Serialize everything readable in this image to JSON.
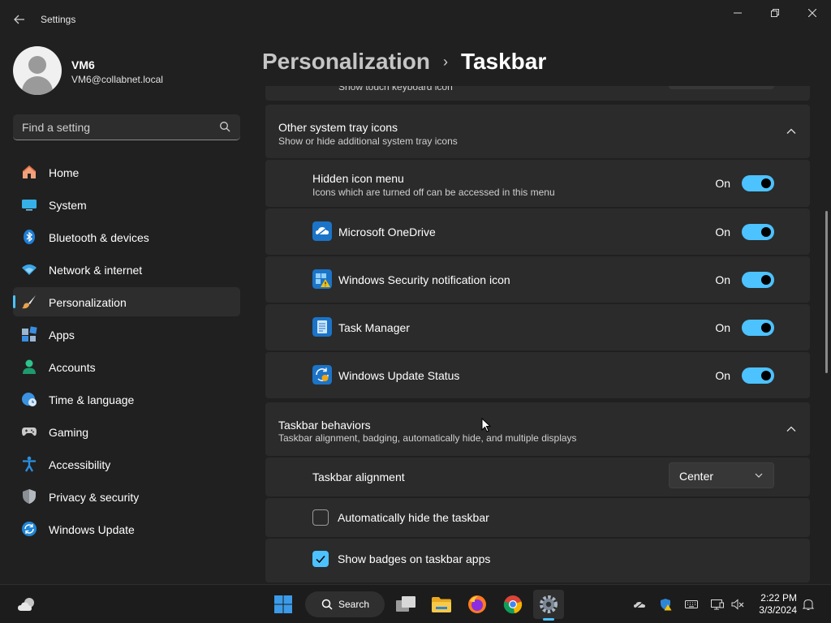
{
  "window": {
    "title": "Settings",
    "back_icon": "arrow-left-icon",
    "controls": [
      "minimize-icon",
      "maximize-icon",
      "close-icon"
    ]
  },
  "profile": {
    "name": "VM6",
    "email": "VM6@collabnet.local"
  },
  "search": {
    "placeholder": "Find a setting",
    "value": ""
  },
  "sidebar": {
    "items": [
      {
        "label": "Home",
        "icon": "home-icon"
      },
      {
        "label": "System",
        "icon": "monitor-icon"
      },
      {
        "label": "Bluetooth & devices",
        "icon": "bluetooth-icon"
      },
      {
        "label": "Network & internet",
        "icon": "wifi-icon"
      },
      {
        "label": "Personalization",
        "icon": "paintbrush-icon",
        "active": true
      },
      {
        "label": "Apps",
        "icon": "apps-icon"
      },
      {
        "label": "Accounts",
        "icon": "person-icon"
      },
      {
        "label": "Time & language",
        "icon": "globe-clock-icon"
      },
      {
        "label": "Gaming",
        "icon": "gamepad-icon"
      },
      {
        "label": "Accessibility",
        "icon": "accessibility-icon"
      },
      {
        "label": "Privacy & security",
        "icon": "shield-icon"
      },
      {
        "label": "Windows Update",
        "icon": "sync-icon"
      }
    ]
  },
  "header": {
    "parent": "Personalization",
    "separator": "›",
    "current": "Taskbar"
  },
  "partial_row": {
    "label": "Show touch keyboard icon"
  },
  "tray_section": {
    "title": "Other system tray icons",
    "subtitle": "Show or hide additional system tray icons",
    "rows": [
      {
        "title": "Hidden icon menu",
        "subtitle": "Icons which are turned off can be accessed in this menu",
        "state": "On",
        "enabled": true
      },
      {
        "title": "Microsoft OneDrive",
        "icon": "onedrive-icon",
        "state": "On",
        "enabled": true
      },
      {
        "title": "Windows Security notification icon",
        "icon": "windows-security-icon",
        "state": "On",
        "enabled": true
      },
      {
        "title": "Task Manager",
        "icon": "task-manager-icon",
        "state": "On",
        "enabled": true
      },
      {
        "title": "Windows Update Status",
        "icon": "windows-update-icon",
        "state": "On",
        "enabled": true
      }
    ]
  },
  "behaviors_section": {
    "title": "Taskbar behaviors",
    "subtitle": "Taskbar alignment, badging, automatically hide, and multiple displays",
    "alignment_label": "Taskbar alignment",
    "alignment_value": "Center",
    "auto_hide_label": "Automatically hide the taskbar",
    "auto_hide_checked": false,
    "badges_label": "Show badges on taskbar apps",
    "badges_checked": true
  },
  "taskbar": {
    "search_label": "Search",
    "apps": [
      "weather-icon",
      "windows-start-icon",
      "task-view-icon",
      "file-explorer-icon",
      "firefox-icon",
      "chrome-icon",
      "settings-gear-icon"
    ],
    "tray": [
      "onedrive-icon",
      "windows-security-icon",
      "keyboard-icon",
      "network-icon",
      "volume-muted-icon",
      "notification-bell-icon"
    ],
    "time": "2:22 PM",
    "date": "3/3/2024"
  },
  "colors": {
    "accent": "#4cc2ff",
    "background": "#202020",
    "card": "#2b2b2b"
  }
}
